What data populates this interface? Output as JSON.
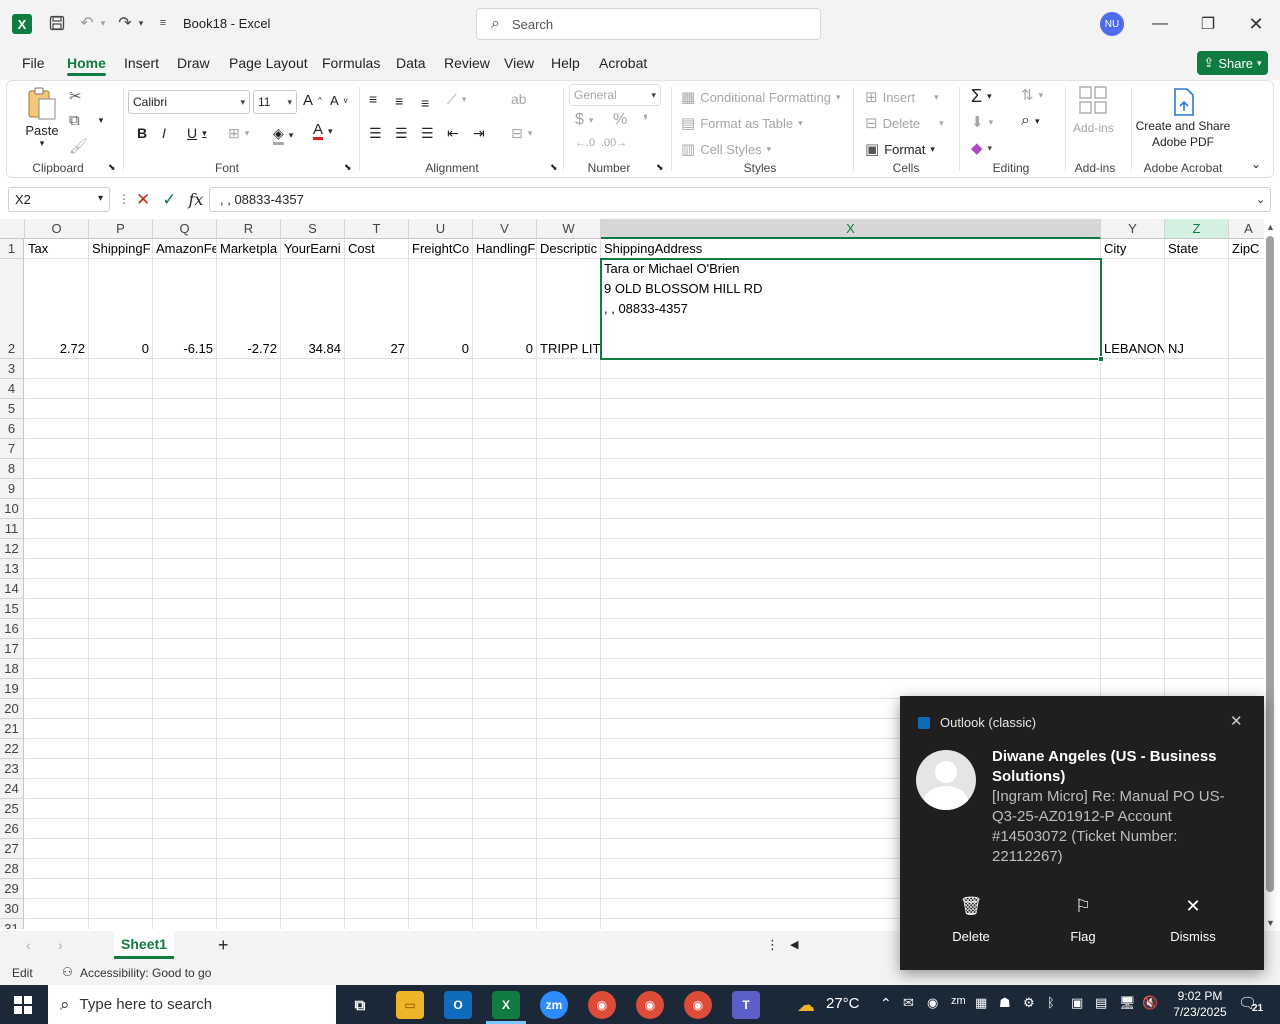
{
  "titlebar": {
    "doc_title": "Book18 - Excel",
    "search_placeholder": "Search",
    "avatar_initials": "NU"
  },
  "menu": [
    "File",
    "Home",
    "Insert",
    "Draw",
    "Page Layout",
    "Formulas",
    "Data",
    "Review",
    "View",
    "Help",
    "Acrobat"
  ],
  "share_label": "Share",
  "ribbon": {
    "paste": "Paste",
    "font_name": "Calibri",
    "font_size": "11",
    "number_format": "General",
    "conditional_formatting": "Conditional Formatting",
    "format_as_table": "Format as Table",
    "cell_styles": "Cell Styles",
    "insert": "Insert",
    "delete": "Delete",
    "format": "Format",
    "addins": "Add-ins",
    "create_share_1": "Create and Share",
    "create_share_2": "Adobe PDF",
    "groups": [
      "Clipboard",
      "Font",
      "Alignment",
      "Number",
      "Styles",
      "Cells",
      "Editing",
      "Add-ins",
      "Adobe Acrobat"
    ]
  },
  "formula_bar": {
    "name_box": "X2",
    "formula": ", , 08833-4357"
  },
  "grid": {
    "columns": [
      "O",
      "P",
      "Q",
      "R",
      "S",
      "T",
      "U",
      "V",
      "W",
      "X",
      "Y",
      "Z",
      "A"
    ],
    "row1": [
      "Tax",
      "ShippingF",
      "AmazonFe",
      "Marketpla",
      "YourEarni",
      "Cost",
      "FreightCo",
      "HandlingF",
      "Descriptic",
      "ShippingAddress",
      "City",
      "State",
      "ZipC"
    ],
    "row2": [
      "2.72",
      "0",
      "-6.15",
      "-2.72",
      "34.84",
      "27",
      "0",
      "0",
      "TRIPP LITE",
      "",
      "LEBANON",
      "NJ",
      ""
    ],
    "address_lines": [
      "Tara or Michael O'Brien",
      "9 OLD BLOSSOM HILL RD",
      ", , 08833-4357"
    ],
    "row_numbers": [
      "1",
      "2",
      "3",
      "4",
      "5",
      "6",
      "7",
      "8",
      "9",
      "10",
      "11",
      "12",
      "13",
      "14",
      "15",
      "16",
      "17",
      "18",
      "19",
      "20",
      "21",
      "22",
      "23",
      "24",
      "25",
      "26",
      "27",
      "28",
      "29",
      "30",
      "31"
    ]
  },
  "sheet_tab": "Sheet1",
  "status": {
    "mode": "Edit",
    "accessibility": "Accessibility: Good to go"
  },
  "toast": {
    "app": "Outlook (classic)",
    "sender": "Diwane Angeles (US - Business Solutions)",
    "message": "[Ingram Micro] Re: Manual PO US-Q3-25-AZ01912-P Account #14503072 (Ticket Number: 22112267)",
    "actions": [
      "Delete",
      "Flag",
      "Dismiss"
    ]
  },
  "taskbar": {
    "search_placeholder": "Type here to search",
    "temperature": "27°C",
    "time": "9:02 PM",
    "date": "7/23/2025",
    "notifications": "21"
  },
  "colors": {
    "accent": "#107c41",
    "avatar": "#4f6bed",
    "toast_bg": "#1f1f1f",
    "taskbar_bg": "#1b2838"
  }
}
